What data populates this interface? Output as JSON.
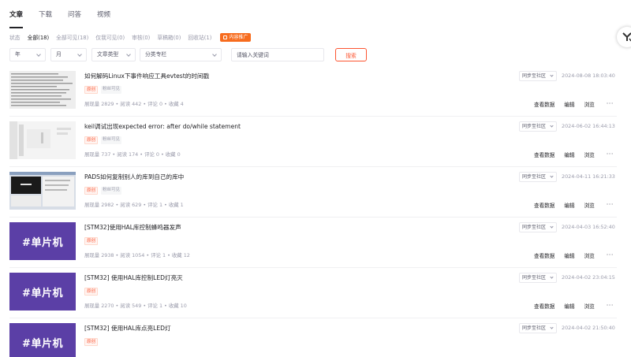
{
  "top_tabs": [
    "文章",
    "下载",
    "问答",
    "视频"
  ],
  "filter_tabs": [
    "状态",
    "全部(18)",
    "全部可见(18)",
    "仅我可见(0)",
    "审核(0)",
    "草稿箱(0)",
    "回收站(1)"
  ],
  "promo_label": "内容推广",
  "search": {
    "year": "年",
    "month": "月",
    "type": "文章类型",
    "column": "分类专栏",
    "keyword_placeholder": "请输入关键词",
    "button": "搜索"
  },
  "labels": {
    "original": "原创",
    "visibility": "粉丝可见",
    "sync": "同步至社区",
    "view_data": "查看数据",
    "edit": "编辑",
    "browse": "浏览",
    "more": "···"
  },
  "thumb_text": "#单片机",
  "articles": [
    {
      "title": "如何解码Linux下事件响应工具evtest的时间戳",
      "date": "2024-08-08 18:03:40",
      "stats": "展现量 2829 • 阅读 442 • 评论 0 • 收藏 4"
    },
    {
      "title": "keil调试出现expected error: after do/while statement",
      "date": "2024-06-02 16:44:13",
      "stats": "展现量 737 • 阅读 174 • 评论 0 • 收藏 0"
    },
    {
      "title": "PADS如何复制别人的库到自己的库中",
      "date": "2024-04-11 16:21:33",
      "stats": "展现量 2982 • 阅读 629 • 评论 1 • 收藏 1"
    },
    {
      "title": "[STM32]使用HAL库控制蜂鸣器发声",
      "date": "2024-04-03 16:52:40",
      "stats": "展现量 2938 • 阅读 1054 • 评论 1 • 收藏 12"
    },
    {
      "title": "[STM32] 使用HAL库控制LED灯亮灭",
      "date": "2024-04-02 23:04:15",
      "stats": "展现量 2270 • 阅读 549 • 评论 1 • 收藏 10"
    },
    {
      "title": "[STM32] 使用HAL库点亮LED灯",
      "date": "2024-04-02 21:50:40",
      "stats": ""
    }
  ]
}
